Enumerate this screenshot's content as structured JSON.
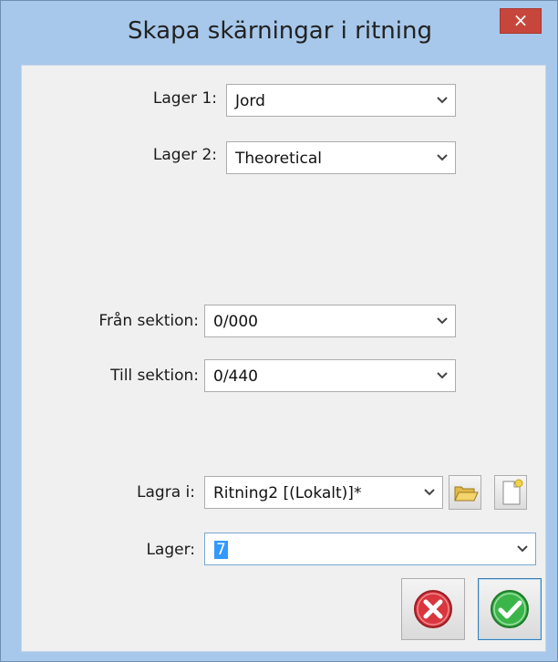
{
  "window": {
    "title": "Skapa skärningar i ritning",
    "close_glyph": "×"
  },
  "form": {
    "lager1": {
      "label": "Lager 1:",
      "value": "Jord"
    },
    "lager2": {
      "label": "Lager 2:",
      "value": "Theoretical"
    },
    "fran_sektion": {
      "label": "Från sektion:",
      "value": "0/000"
    },
    "till_sektion": {
      "label": "Till sektion:",
      "value": "0/440"
    },
    "lagra_i": {
      "label": "Lagra i:",
      "value": "Ritning2 [(Lokalt)]*"
    },
    "lager": {
      "label": "Lager:",
      "value": "7"
    }
  },
  "icons": {
    "dropdown": "chevron-down-icon",
    "open": "folder-open-icon",
    "new": "new-document-icon",
    "cancel": "cancel-icon",
    "ok": "ok-checkmark-icon"
  },
  "colors": {
    "title_bar": "#a7c8ea",
    "close_button": "#c7463c",
    "cancel_red": "#d9363e",
    "ok_green": "#3bb54a",
    "selection": "#3399ff"
  }
}
